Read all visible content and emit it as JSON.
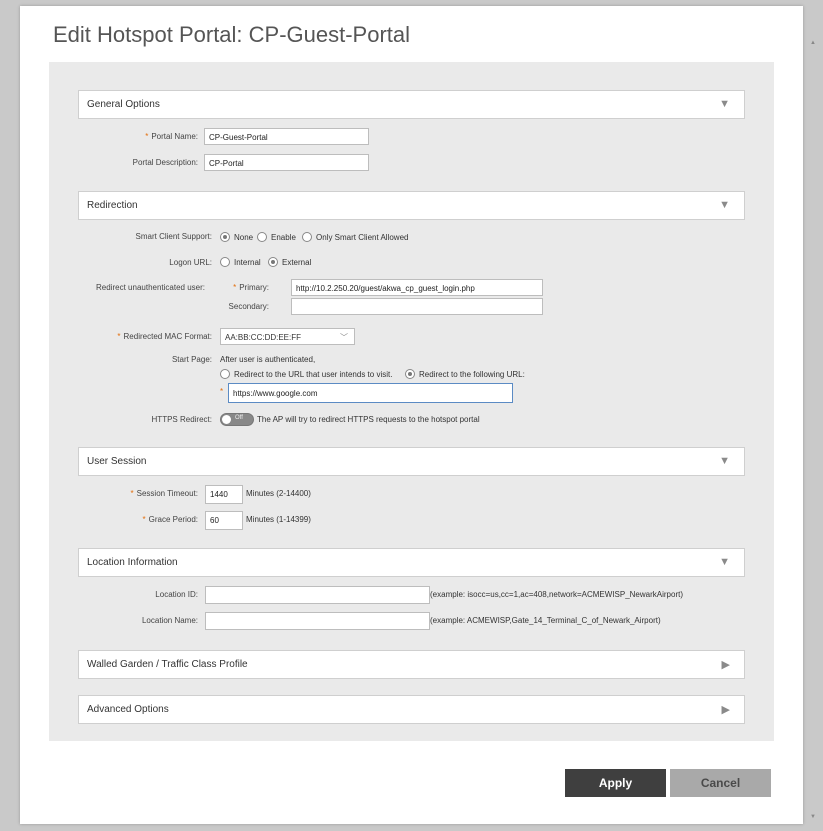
{
  "dialog": {
    "title": "Edit Hotspot Portal: CP-Guest-Portal"
  },
  "sections": {
    "general": {
      "label": "General Options",
      "toggle": "▼"
    },
    "redirection": {
      "label": "Redirection",
      "toggle": "▼"
    },
    "user_session": {
      "label": "User Session",
      "toggle": "▼"
    },
    "location": {
      "label": "Location Information",
      "toggle": "▼"
    },
    "walled_garden": {
      "label": "Walled Garden / Traffic Class Profile",
      "toggle": "▶"
    },
    "advanced": {
      "label": "Advanced Options",
      "toggle": "▶"
    }
  },
  "general": {
    "portal_name_label": "Portal Name:",
    "portal_name_value": "CP-Guest-Portal",
    "portal_desc_label": "Portal Description:",
    "portal_desc_value": "CP-Portal"
  },
  "redirection": {
    "smart_client_label": "Smart Client Support:",
    "smart_client_options": [
      "None",
      "Enable",
      "Only Smart Client Allowed"
    ],
    "smart_client_selected": "None",
    "logon_url_label": "Logon URL:",
    "logon_url_options": [
      "Internal",
      "External"
    ],
    "logon_url_selected": "External",
    "redirect_unauth_label": "Redirect unauthenticated user:",
    "primary_label": "Primary:",
    "primary_value": "http://10.2.250.20/guest/akwa_cp_guest_login.php",
    "secondary_label": "Secondary:",
    "secondary_value": "",
    "mac_format_label": "Redirected MAC Format:",
    "mac_format_value": "AA:BB:CC:DD:EE:FF",
    "start_page_label": "Start Page:",
    "start_page_note": "After user is authenticated,",
    "start_page_options": [
      "Redirect to the URL that user intends to visit.",
      "Redirect to the following URL:"
    ],
    "start_page_selected": "Redirect to the following URL:",
    "start_url_value": "https://www.google.com",
    "https_redirect_label": "HTTPS Redirect:",
    "https_toggle_state": "Off",
    "https_redirect_text": "The AP will try to redirect HTTPS requests to the hotspot portal"
  },
  "user_session": {
    "timeout_label": "Session Timeout:",
    "timeout_value": "1440",
    "timeout_hint": "Minutes (2-14400)",
    "grace_label": "Grace Period:",
    "grace_value": "60",
    "grace_hint": "Minutes (1-14399)"
  },
  "location": {
    "id_label": "Location ID:",
    "id_value": "",
    "id_example": "(example: isocc=us,cc=1,ac=408,network=ACMEWISP_NewarkAirport)",
    "name_label": "Location Name:",
    "name_value": "",
    "name_example": "(example: ACMEWISP,Gate_14_Terminal_C_of_Newark_Airport)"
  },
  "buttons": {
    "apply": "Apply",
    "cancel": "Cancel"
  },
  "required_mark": "*"
}
